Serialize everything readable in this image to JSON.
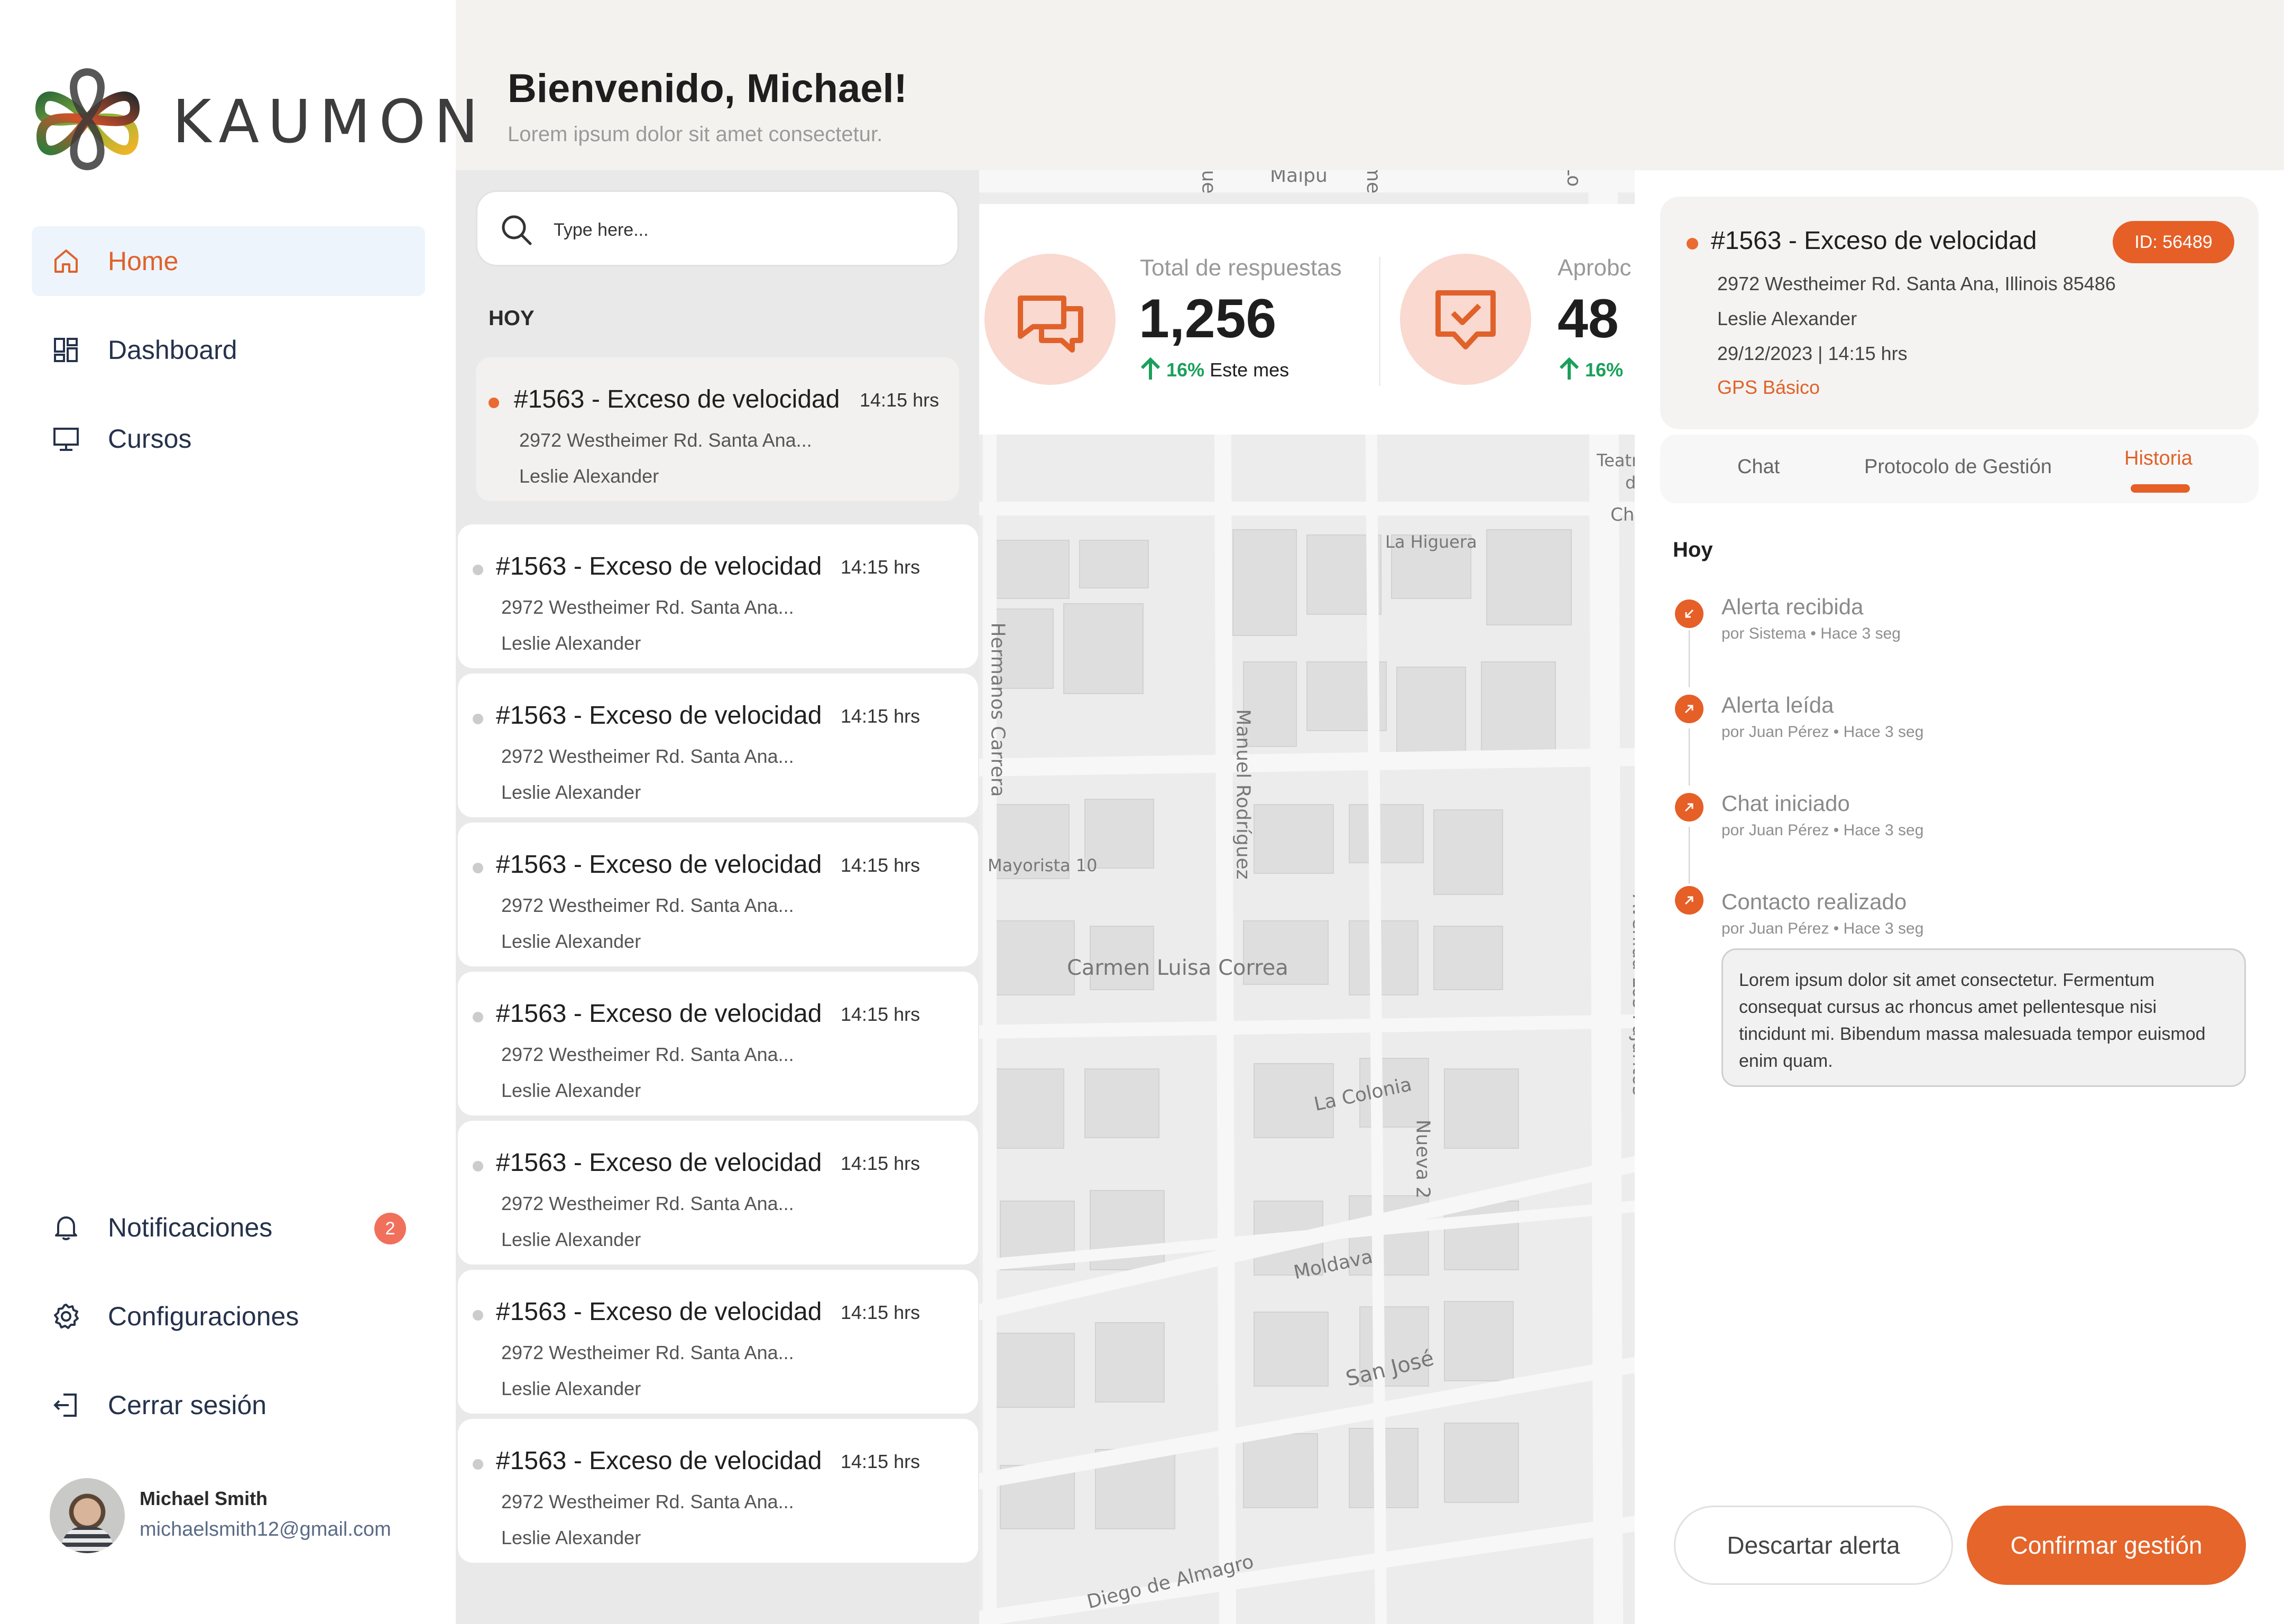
{
  "brand": {
    "name": "KAUMON"
  },
  "sidebar": {
    "nav": [
      {
        "label": "Home",
        "icon": "home-icon",
        "active": true
      },
      {
        "label": "Dashboard",
        "icon": "dashboard-icon"
      },
      {
        "label": "Cursos",
        "icon": "monitor-icon"
      }
    ],
    "bottom": [
      {
        "label": "Notificaciones",
        "icon": "bell-icon",
        "badge": "2"
      },
      {
        "label": "Configuraciones",
        "icon": "gear-icon"
      },
      {
        "label": "Cerrar sesión",
        "icon": "logout-icon"
      }
    ],
    "user": {
      "name": "Michael Smith",
      "email": "michaelsmith12@gmail.com"
    }
  },
  "header": {
    "title": "Bienvenido, Michael!",
    "subtitle": "Lorem ipsum dolor sit amet consectetur."
  },
  "search": {
    "placeholder": "Type here..."
  },
  "alerts": {
    "section": "HOY",
    "items": [
      {
        "title": "#1563 -  Exceso de velocidad",
        "time": "14:15 hrs",
        "address": "2972 Westheimer Rd. Santa Ana...",
        "person": "Leslie Alexander",
        "selected": true
      },
      {
        "title": "#1563 -  Exceso de velocidad",
        "time": "14:15 hrs",
        "address": "2972 Westheimer Rd. Santa Ana...",
        "person": "Leslie Alexander"
      },
      {
        "title": "#1563 -  Exceso de velocidad",
        "time": "14:15 hrs",
        "address": "2972 Westheimer Rd. Santa Ana...",
        "person": "Leslie Alexander"
      },
      {
        "title": "#1563 -  Exceso de velocidad",
        "time": "14:15 hrs",
        "address": "2972 Westheimer Rd. Santa Ana...",
        "person": "Leslie Alexander"
      },
      {
        "title": "#1563 -  Exceso de velocidad",
        "time": "14:15 hrs",
        "address": "2972 Westheimer Rd. Santa Ana...",
        "person": "Leslie Alexander"
      },
      {
        "title": "#1563 -  Exceso de velocidad",
        "time": "14:15 hrs",
        "address": "2972 Westheimer Rd. Santa Ana...",
        "person": "Leslie Alexander"
      },
      {
        "title": "#1563 -  Exceso de velocidad",
        "time": "14:15 hrs",
        "address": "2972 Westheimer Rd. Santa Ana...",
        "person": "Leslie Alexander"
      },
      {
        "title": "#1563 -  Exceso de velocidad",
        "time": "14:15 hrs",
        "address": "2972 Westheimer Rd. Santa Ana...",
        "person": "Leslie Alexander"
      }
    ]
  },
  "stats": [
    {
      "label": "Total de respuestas",
      "value": "1,256",
      "trend": "16%",
      "trend_suffix": "Este mes",
      "icon": "chat-icon"
    },
    {
      "label": "Aprobc",
      "value": "48",
      "trend": "16%",
      "icon": "approved-chat-icon"
    }
  ],
  "map": {
    "labels": [
      "Maipú",
      "La Higuera",
      "Hermanos Carrera",
      "Mayorista 10",
      "Manuel Rodríguez",
      "Carmen Luisa Correa",
      "La Colonia",
      "Nueva 2",
      "Avenida Los Pajaritos",
      "Moldava",
      "San José",
      "Diego de Almagro",
      "Teatr",
      "d",
      "Ch",
      "gue",
      "ime",
      "Lo"
    ]
  },
  "detail": {
    "title": "#1563 -  Exceso de velocidad",
    "id": "ID: 56489",
    "address": "2972 Westheimer Rd. Santa Ana, Illinois 85486",
    "person": "Leslie Alexander",
    "datetime": "29/12/2023 | 14:15 hrs",
    "plan": "GPS Básico",
    "tabs": [
      "Chat",
      "Protocolo de Gestión",
      "Historia"
    ],
    "active_tab": "Historia",
    "history_day": "Hoy",
    "timeline": [
      {
        "title": "Alerta recibida",
        "meta": "por Sistema • Hace 3 seg"
      },
      {
        "title": "Alerta leída",
        "meta": "por Juan Pérez • Hace 3 seg"
      },
      {
        "title": "Chat iniciado",
        "meta": "por Juan Pérez • Hace 3 seg"
      },
      {
        "title": "Contacto realizado",
        "meta": "por Juan Pérez • Hace 3 seg"
      }
    ],
    "note": "Lorem ipsum dolor sit amet consectetur. Fermentum consequat cursus ac rhoncus amet pellentesque nisi tincidunt mi. Bibendum massa malesuada tempor euismod enim quam.",
    "actions": {
      "discard": "Descartar alerta",
      "confirm": "Confirmar gestión"
    }
  },
  "colors": {
    "accent": "#e5652b",
    "active_nav_bg": "#eef4fc",
    "trend_up": "#1aa05a",
    "stat_circle": "#f9d9d0",
    "badge": "#f0705c"
  }
}
